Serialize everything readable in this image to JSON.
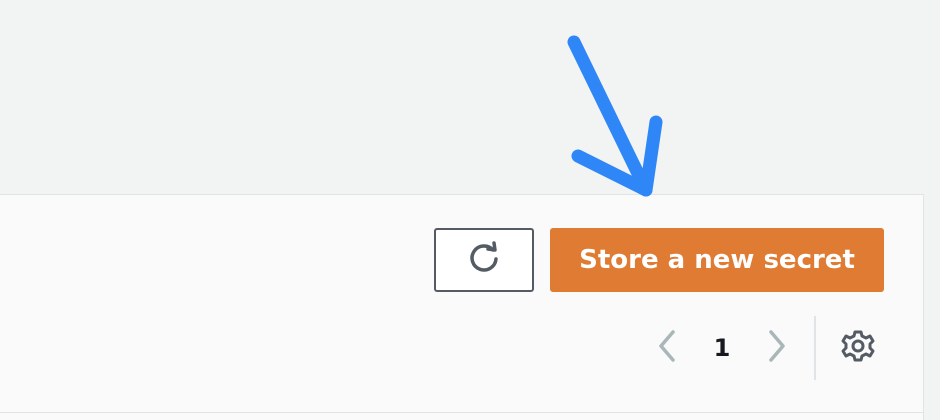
{
  "toolbar": {
    "refresh_icon": "refresh-icon",
    "primary_button_label": "Store a new secret",
    "primary_button_color": "#e07b33"
  },
  "pagination": {
    "current_page": "1",
    "prev_icon": "chevron-left-icon",
    "next_icon": "chevron-right-icon",
    "settings_icon": "gear-icon"
  },
  "annotation": {
    "arrow_color": "#2f86f6"
  }
}
